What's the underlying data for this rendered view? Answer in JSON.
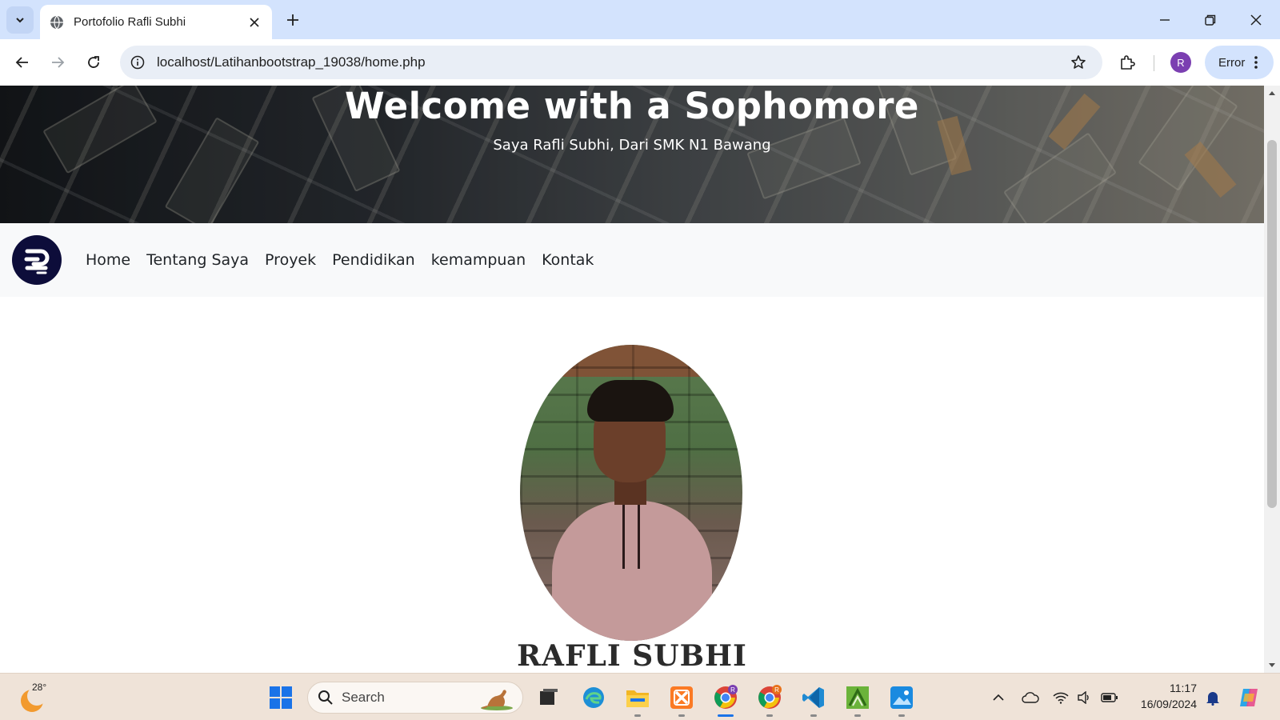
{
  "browser": {
    "tab_title": "Portofolio Rafli Subhi",
    "url": "localhost/Latihanbootstrap_19038/home.php",
    "profile_initial": "R",
    "error_chip": "Error"
  },
  "hero": {
    "title": "Welcome with a Sophomore",
    "subtitle": "Saya Rafli Subhi, Dari SMK N1 Bawang"
  },
  "navbar": {
    "links": [
      "Home",
      "Tentang Saya",
      "Proyek",
      "Pendidikan",
      "kemampuan",
      "Kontak"
    ]
  },
  "profile": {
    "name": "RAFLI SUBHI"
  },
  "taskbar": {
    "weather_temp": "28°",
    "search_label": "Search",
    "time": "11:17",
    "date": "16/09/2024",
    "chrome_badge_1": "R",
    "chrome_badge_2": "R"
  },
  "colors": {
    "tabbar_bg": "#d3e3fd",
    "omnibox_bg": "#e9eef6",
    "navbar_bg": "#f8f9fa",
    "taskbar_bg": "#efe3d8",
    "brand_logo_bg": "#0d0d3a",
    "profile_avatar": "#7b3fb1"
  },
  "icons": [
    "tab-search-icon",
    "globe-icon",
    "close-icon",
    "plus-icon",
    "minimize-icon",
    "restore-icon",
    "back-icon",
    "forward-icon",
    "reload-icon",
    "site-info-icon",
    "star-icon",
    "extensions-icon",
    "more-vertical-icon",
    "windows-start-icon",
    "search-icon",
    "task-view-icon",
    "edge-icon",
    "file-explorer-icon",
    "xampp-icon",
    "chrome-icon",
    "vscode-icon",
    "sublime-icon",
    "photos-icon",
    "chevron-up-icon",
    "onedrive-icon",
    "wifi-icon",
    "volume-icon",
    "battery-icon",
    "bell-icon",
    "copilot-icon"
  ]
}
